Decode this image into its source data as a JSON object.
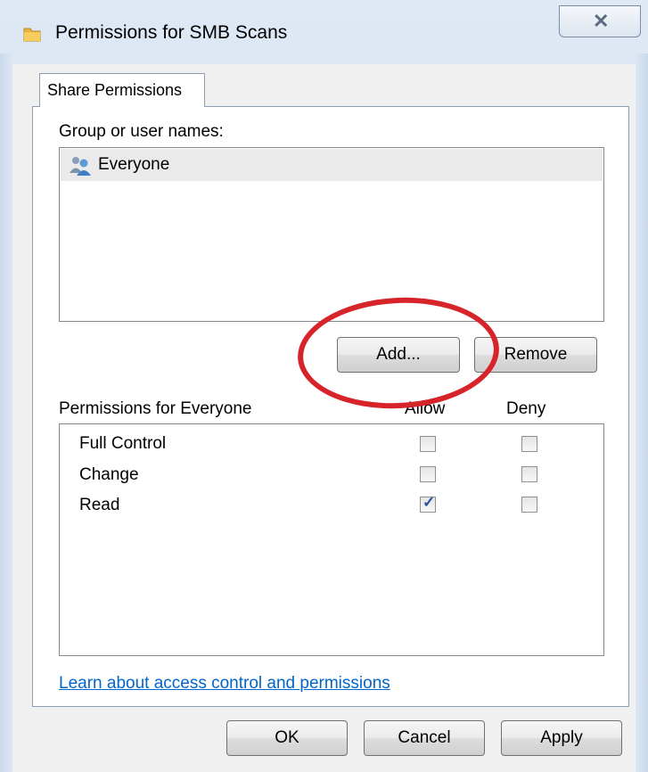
{
  "window": {
    "title": "Permissions for SMB Scans",
    "close_glyph": "✕"
  },
  "tabs": [
    {
      "label": "Share Permissions"
    }
  ],
  "group_list": {
    "label": "Group or user names:",
    "items": [
      {
        "name": "Everyone",
        "icon": "users-icon"
      }
    ]
  },
  "buttons": {
    "add": "Add...",
    "remove": "Remove",
    "ok": "OK",
    "cancel": "Cancel",
    "apply": "Apply"
  },
  "permissions": {
    "label": "Permissions for Everyone",
    "col_allow": "Allow",
    "col_deny": "Deny",
    "rows": [
      {
        "name": "Full Control",
        "allow": false,
        "deny": false
      },
      {
        "name": "Change",
        "allow": false,
        "deny": false
      },
      {
        "name": "Read",
        "allow": true,
        "deny": false
      }
    ]
  },
  "link": "Learn about access control and permissions",
  "colors": {
    "annotation_circle": "#d6242a",
    "link": "#0066cc"
  }
}
